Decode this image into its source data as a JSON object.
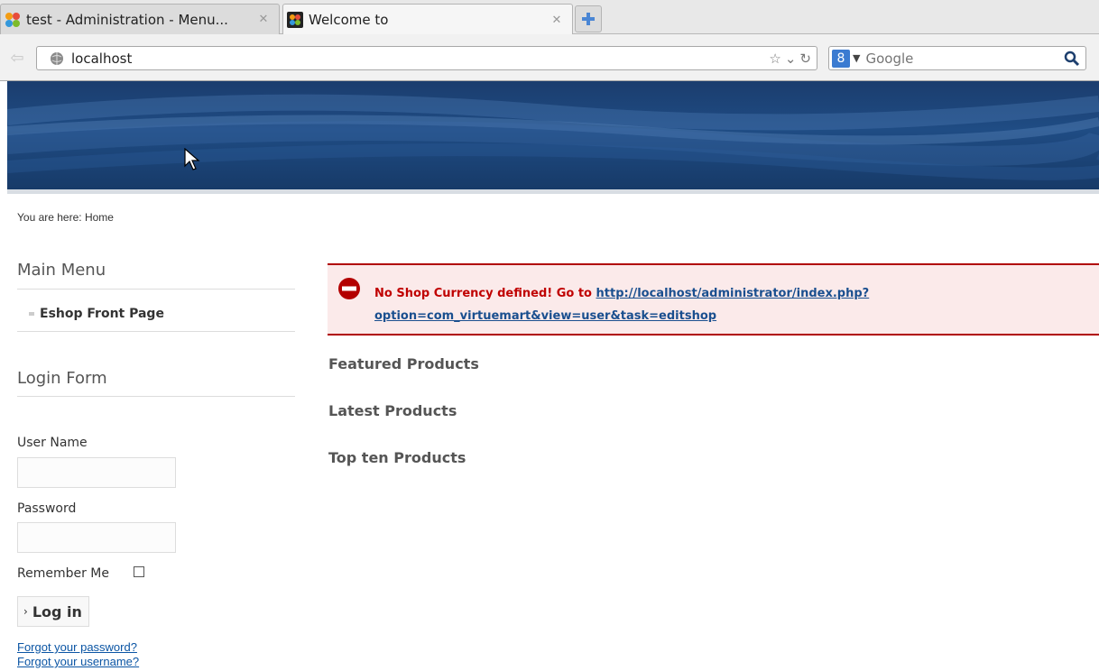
{
  "browser": {
    "tabs": [
      {
        "title": "test - Administration - Menu...",
        "active": false
      },
      {
        "title": "Welcome to",
        "active": true
      }
    ],
    "url": "localhost",
    "search_placeholder": "Google",
    "search_engine_letter": "8"
  },
  "page": {
    "breadcrumb": "You are here: Home",
    "main_menu": {
      "title": "Main Menu",
      "items": [
        "Eshop Front Page"
      ]
    },
    "login_form": {
      "title": "Login Form",
      "username_label": "User Name",
      "password_label": "Password",
      "remember_label": "Remember Me",
      "login_button": "Log in",
      "forgot_password": "Forgot your password?",
      "forgot_username": "Forgot your username?"
    },
    "alert": {
      "prefix": "No Shop Currency defined! Go to ",
      "url": "http://localhost/administrator/index.php?option=com_virtuemart&view=user&task=editshop"
    },
    "sections": [
      "Featured Products",
      "Latest Products",
      "Top ten Products"
    ]
  },
  "colors": {
    "alert_red": "#c00000",
    "link_blue": "#0b55a4",
    "banner_blue": "#1f4c84"
  }
}
